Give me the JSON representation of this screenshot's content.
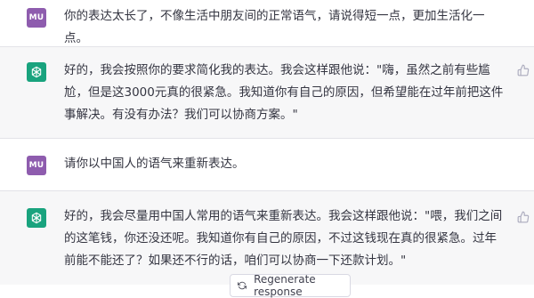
{
  "messages": [
    {
      "role": "user",
      "avatar": "MU",
      "text": "你的表达太长了，不像生活中朋友间的正常语气，请说得短一点，更加生活化一点。"
    },
    {
      "role": "assistant",
      "avatar_icon": "chatgpt-logo-icon",
      "text": "好的，我会按照你的要求简化我的表达。我会这样跟他说：\"嗨，虽然之前有些尴尬，但是这3000元真的很紧急。我知道你有自己的原因，但希望能在过年前把这件事解决。有没有办法？我们可以协商方案。\"",
      "feedback_icon": "thumbs-up-icon"
    },
    {
      "role": "user",
      "avatar": "MU",
      "text": "请你以中国人的语气来重新表达。"
    },
    {
      "role": "assistant",
      "avatar_icon": "chatgpt-logo-icon",
      "text": "好的，我会尽量用中国人常用的语气来重新表达。我会这样跟他说：\"喂，我们之间的这笔钱，你还没还呢。我知道你有自己的原因，不过这钱现在真的很紧急。过年前能不能还了？如果还不行的话，咱们可以协商一下还款计划。\"",
      "feedback_icon": "thumbs-up-icon"
    }
  ],
  "regenerate_button": {
    "label": "Regenerate response",
    "icon": "refresh-icon"
  },
  "colors": {
    "user_bg": "#ffffff",
    "assistant_bg": "#f7f7f8",
    "user_avatar": "#8e5cae",
    "assistant_avatar": "#19a37e",
    "text": "#343541"
  }
}
